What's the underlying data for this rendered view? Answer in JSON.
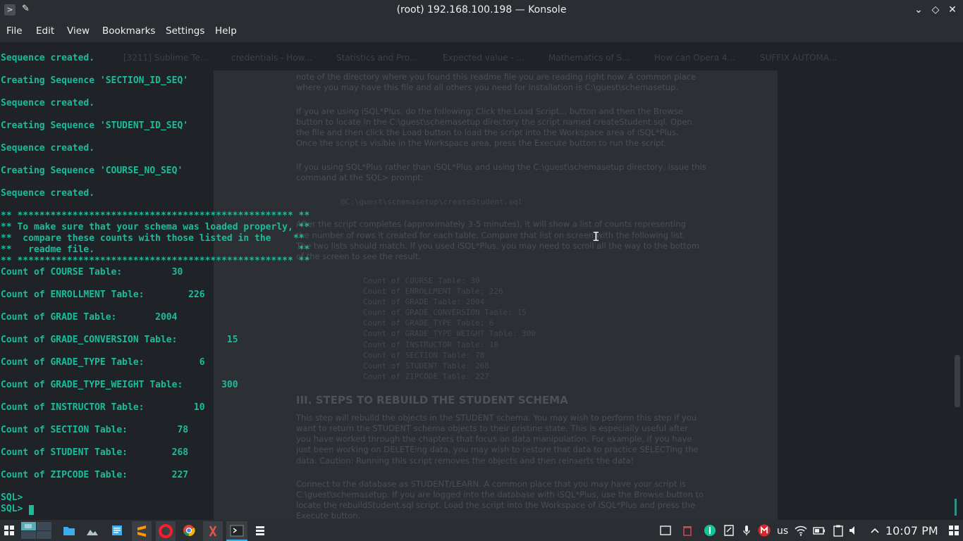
{
  "window": {
    "title": "(root) 192.168.100.198 — Konsole",
    "app_icon": ">",
    "pin_icon": "✎",
    "controls": {
      "minimize": "⌄",
      "maximize": "◇",
      "close": "✕"
    }
  },
  "menu": [
    "File",
    "Edit",
    "View",
    "Bookmarks",
    "Settings",
    "Help"
  ],
  "terminal_lines": [
    "Sequence created.",
    "Creating Sequence 'SECTION_ID_SEQ'",
    "Sequence created.",
    "Creating Sequence 'STUDENT_ID_SEQ'",
    "Sequence created.",
    "Creating Sequence 'COURSE_NO_SEQ'",
    "Sequence created.",
    "** ************************************************** **",
    "** To make sure that your schema was loaded properly, **",
    "**  compare these counts with those listed in the    **",
    "**   readme file.                                     **",
    "** ************************************************** **",
    "Count of COURSE Table:         30",
    "Count of ENROLLMENT Table:        226",
    "Count of GRADE Table:       2004",
    "Count of GRADE_CONVERSION Table:         15",
    "Count of GRADE_TYPE Table:          6",
    "Count of GRADE_TYPE_WEIGHT Table:       300",
    "Count of INSTRUCTOR Table:         10",
    "Count of SECTION Table:         78",
    "Count of STUDENT Table:        268",
    "Count of ZIPCODE Table:        227",
    "SQL>",
    "SQL>"
  ],
  "background_window": {
    "tabs": [
      "[3211] Sublime Te...",
      "credentials - How...",
      "Statistics and Pro...",
      "Expected value - ...",
      "Mathematics of S...",
      "How can Opera 4...",
      "SUFFIX AUTOMA..."
    ],
    "paragraphs": [
      "note of the directory where you found this readme file you are reading right now. A common place",
      "where you may have this file and all others you need for installation is C:\\guest\\schemasetup.",
      "If you are using iSQL*Plus, do the following: Click the Load Script... button and then the Browse",
      "button to locate in the C:\\guest\\schemasetup directory the script named createStudent.sql.  Open",
      "the file and then click the Load button to load the script into the Workspace area of iSQL*Plus.",
      "Once the script is visible in the Workspace area, press the Execute button to run the script.",
      "If you using SQL*Plus rather than iSQL*Plus and using the C:\\guest\\schemasetup directory, issue this",
      "command at the SQL> prompt:",
      "@C:\\guest\\schemasetup\\createStudent.sql",
      "After the script completes (approximately 3-5 minutes), it will show a list of counts representing",
      "the number of rows it created for each table. Compare that list on screen with the following list.",
      "The two lists should match. If you used iSQL*Plus, you may need to scroll all the way to the bottom",
      "of the screen to see the result.",
      "Count of COURSE Table: 30",
      "Count of ENROLLMENT Table: 226",
      "Count of GRADE Table: 2004",
      "Count of GRADE_CONVERSION Table: 15",
      "Count of GRADE_TYPE Table: 6",
      "Count of GRADE_TYPE_WEIGHT Table: 300",
      "Count of INSTRUCTOR Table: 10",
      "Count of SECTION Table: 78",
      "Count of STUDENT Table: 268",
      "Count of ZIPCODE Table: 227",
      "III. STEPS TO REBUILD THE STUDENT SCHEMA",
      "This step will rebuild the objects in the STUDENT schema. You may wish to perform this step if you",
      "want to return the STUDENT schema objects to their pristine state. This is especially useful after",
      "you have worked through the chapters that focus on data manipulation. For example, if you have",
      "just been working on DELETEing data, you may wish to restore that data to practice SELECTing the",
      "data. Caution: Running this script removes the objects and then reinserts the data!",
      "Connect to the database as STUDENT/LEARN. A common place that you may have your script is",
      "C:\\guest\\schemasetup. If you are logged into the database with iSQL*Plus, use the Browse button to",
      "locate the rebuildStudent.sql script. Load the script into the Workspace of iSQL*Plus and press the",
      "Execute button."
    ]
  },
  "taskbar": {
    "keyboard_layout": "us",
    "clock": "10:07 PM",
    "icons": [
      "start-menu-icon",
      "pager-icon",
      "file-manager-icon",
      "image-viewer-icon",
      "text-editor-icon",
      "sublime-icon",
      "opera-icon",
      "chrome-icon",
      "gitkraken-icon",
      "konsole-icon",
      "tasks-icon",
      "window-icon",
      "trash-icon",
      "grammarly-icon",
      "notes-icon",
      "microphone-icon",
      "mega-icon",
      "wifi-icon",
      "battery-icon",
      "clipboard-icon",
      "volume-icon",
      "tray-expand-icon",
      "show-desktop-icon"
    ]
  },
  "colors": {
    "terminal_text": "#1abc9c",
    "terminal_bg": "#1f2226",
    "titlebar": "#2a2e32"
  }
}
